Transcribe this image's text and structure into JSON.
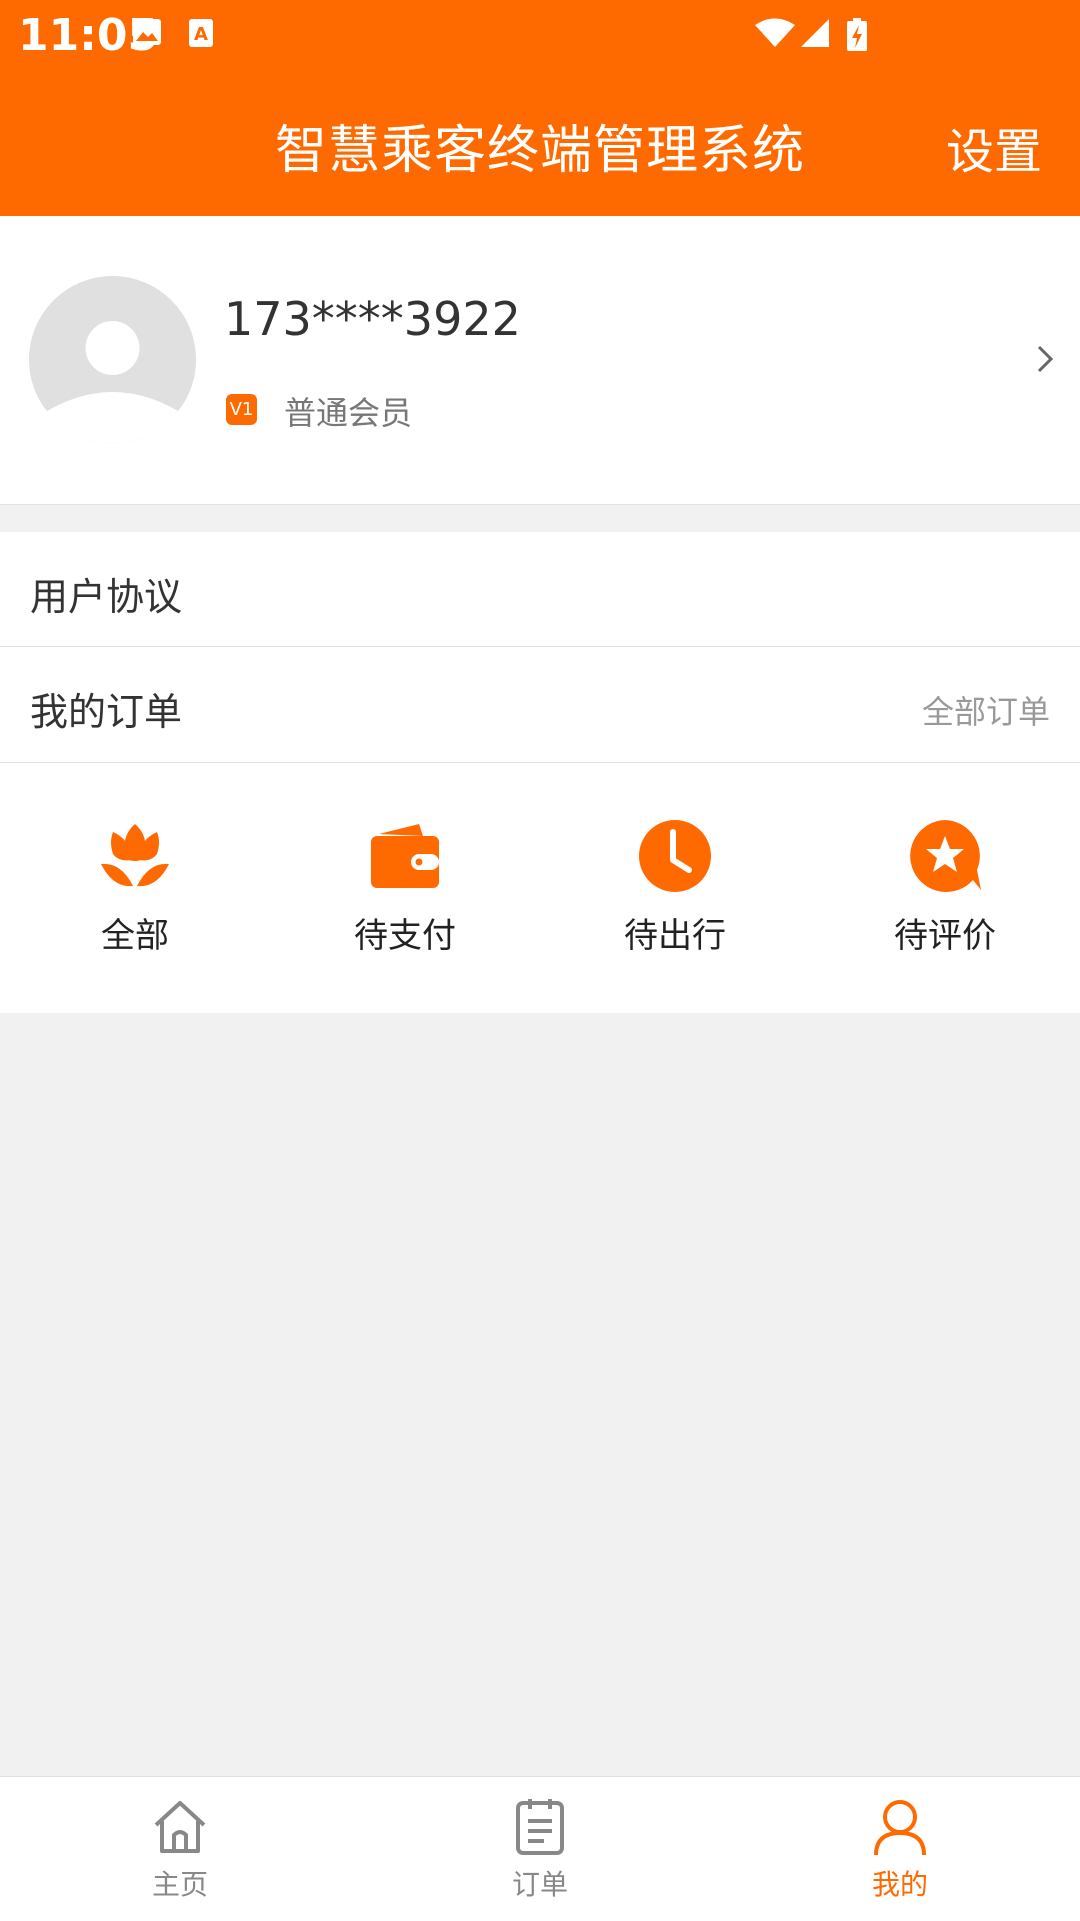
{
  "status_bar": {
    "time": "11:05"
  },
  "header": {
    "title": "智慧乘客终端管理系统",
    "settings_label": "设置"
  },
  "profile": {
    "phone": "173****3922",
    "badge": "V1",
    "member_level": "普通会员"
  },
  "menu": {
    "agreement_label": "用户协议",
    "orders_label": "我的订单",
    "all_orders_link": "全部订单"
  },
  "order_shortcuts": [
    {
      "label": "全部",
      "icon": "flower-icon"
    },
    {
      "label": "待支付",
      "icon": "wallet-icon"
    },
    {
      "label": "待出行",
      "icon": "clock-icon"
    },
    {
      "label": "待评价",
      "icon": "star-bubble-icon"
    }
  ],
  "tabbar": {
    "items": [
      {
        "label": "主页",
        "icon": "home-icon",
        "active": false
      },
      {
        "label": "订单",
        "icon": "list-icon",
        "active": false
      },
      {
        "label": "我的",
        "icon": "user-icon",
        "active": true
      }
    ]
  },
  "colors": {
    "accent": "#ff6a00",
    "background": "#f1f1f1",
    "inactive": "#888888"
  }
}
